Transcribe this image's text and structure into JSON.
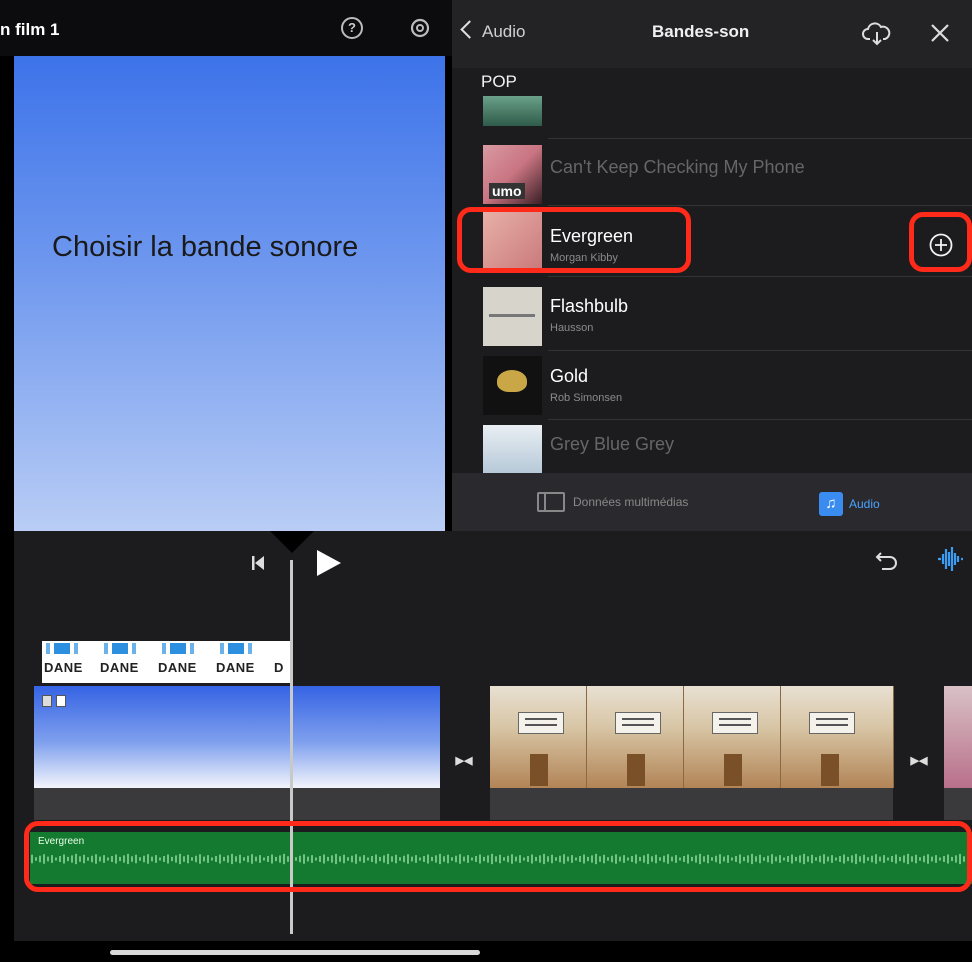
{
  "preview": {
    "project_title": "n film 1",
    "caption": "Choisir la bande sonore"
  },
  "panel": {
    "back_label": "Audio",
    "title": "Bandes-son",
    "section": "POP",
    "items": [
      {
        "title": "",
        "subtitle": "",
        "dimmed": true
      },
      {
        "title": "Can't Keep Checking My Phone",
        "subtitle": "",
        "dimmed": true
      },
      {
        "title": "Evergreen",
        "subtitle": "Morgan Kibby",
        "dimmed": false
      },
      {
        "title": "Flashbulb",
        "subtitle": "Hausson",
        "dimmed": false
      },
      {
        "title": "Gold",
        "subtitle": "Rob Simonsen",
        "dimmed": false
      },
      {
        "title": "Grey Blue Grey",
        "subtitle": "",
        "dimmed": true
      }
    ],
    "thumb_text_1": "umo",
    "tabs": {
      "media": "Données multimédias",
      "audio": "Audio"
    }
  },
  "timeline": {
    "title_strip_word": "DANE",
    "audio_track_label": "Evergreen"
  },
  "colors": {
    "highlight": "#ff2a1a",
    "accent": "#3a8cf0",
    "audio_track": "#147a2f"
  }
}
